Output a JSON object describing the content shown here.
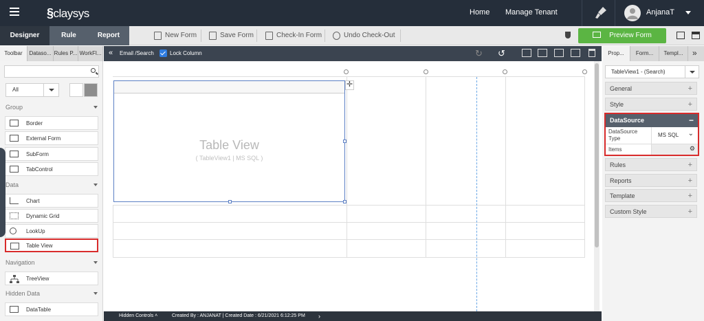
{
  "header": {
    "logo": "claysys",
    "nav": [
      "Home",
      "Manage Tenant"
    ],
    "user": "AnjanaT"
  },
  "main_tabs": [
    "Designer",
    "Rule",
    "Report"
  ],
  "toolbar": {
    "new_form": "New Form",
    "save_form": "Save Form",
    "check_in": "Check-In Form",
    "undo_checkout": "Undo Check-Out",
    "preview": "Preview Form"
  },
  "left_tabs": [
    "Toolbar",
    "Dataso...",
    "Rules P...",
    "WorkFl..."
  ],
  "left_panel": {
    "filter": "All",
    "groups": {
      "group": "Group",
      "data": "Data",
      "navigation": "Navigation",
      "hidden": "Hidden Data"
    },
    "group_items": [
      "Border",
      "External Form",
      "SubForm",
      "TabControl"
    ],
    "data_items": [
      "Chart",
      "Dynamic Grid",
      "LookUp",
      "Table View"
    ],
    "nav_items": [
      "TreeView"
    ],
    "hidden_items": [
      "DataTable"
    ]
  },
  "canvas_toolbar": {
    "breadcrumb": "Email /Search",
    "lock": "Lock Column"
  },
  "canvas": {
    "table_title": "Table View",
    "table_sub": "( TableView1 | MS SQL )"
  },
  "status": {
    "hidden": "Hidden Controls",
    "created": "Created By : ANJANAT | Created Date : 6/21/2021 6:12:25 PM"
  },
  "right_tabs": [
    "Prop...",
    "Form...",
    "Templ..."
  ],
  "right_panel": {
    "control": "TableView1 - (Search)",
    "sections_top": [
      "General",
      "Style"
    ],
    "datasource": {
      "title": "DataSource",
      "type_label": "DataSource Type",
      "type_value": "MS SQL",
      "items_label": "Items"
    },
    "sections_bottom": [
      "Rules",
      "Reports",
      "Template",
      "Custom Style"
    ]
  },
  "colors": {
    "accent_green": "#5bb543",
    "highlight_red": "#d82b2b",
    "dark": "#252e3a"
  }
}
